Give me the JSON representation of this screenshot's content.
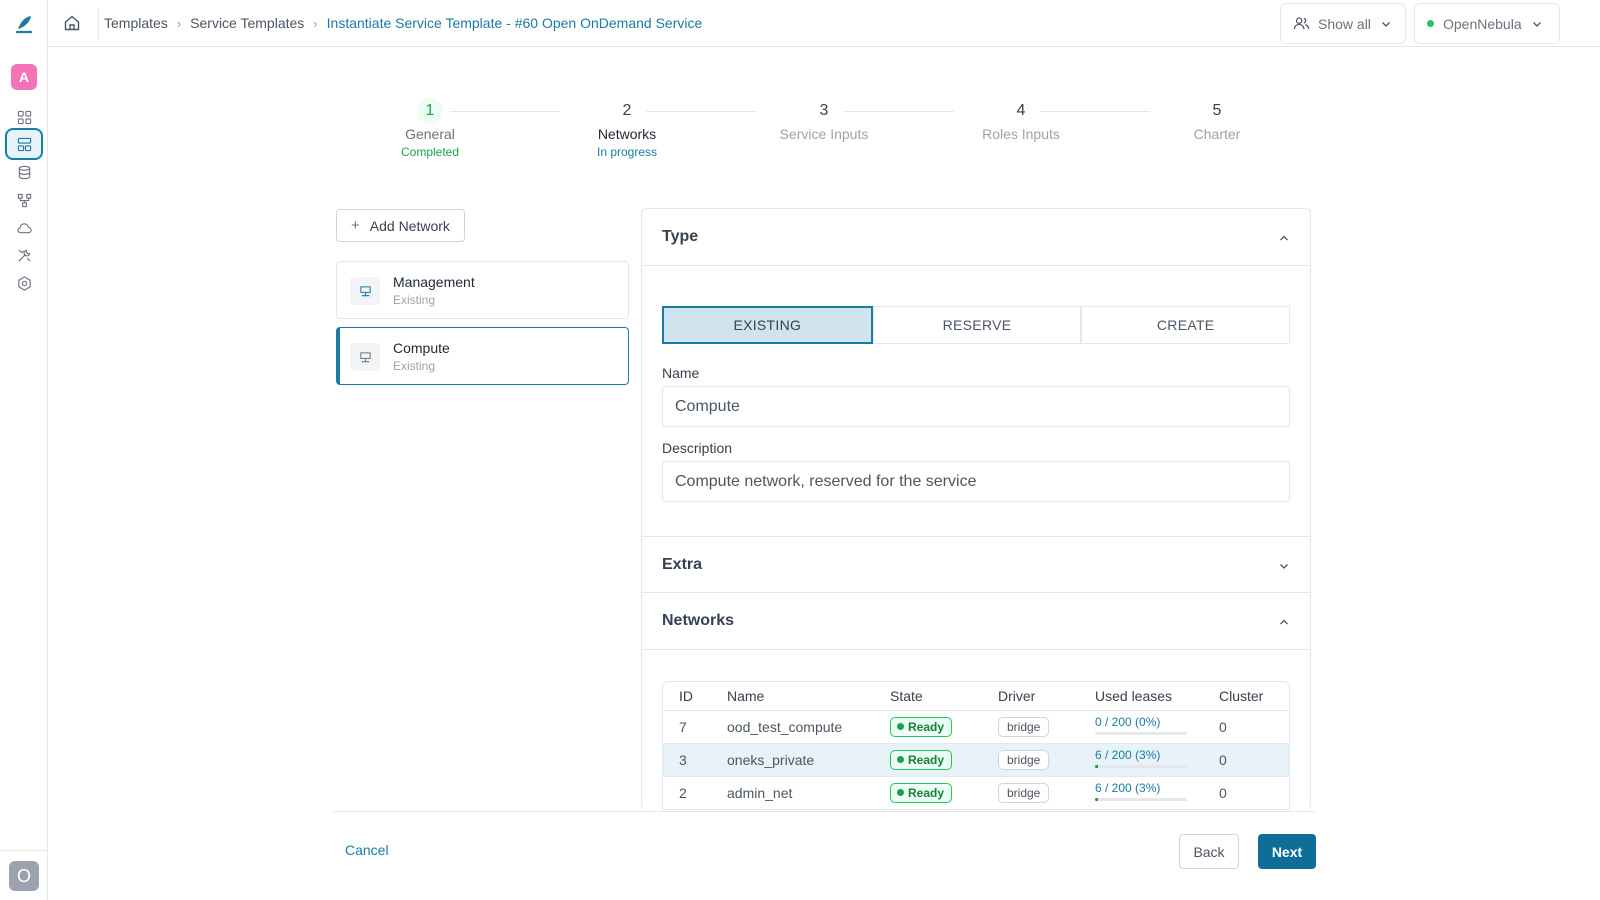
{
  "colors": {
    "accent": "#1a7ba3",
    "success": "#16a34a",
    "avatar": "#f472b6"
  },
  "sidebar": {
    "avatar_letter": "A",
    "user_letter": "O",
    "icons": [
      "dashboard-icon",
      "templates-icon",
      "storage-icon",
      "network-icon",
      "cloud-icon",
      "tools-icon",
      "settings-icon"
    ]
  },
  "header": {
    "breadcrumb": [
      "Templates",
      "Service Templates",
      "Instantiate Service Template - #60 Open OnDemand Service"
    ],
    "show_all_label": "Show all",
    "zone_label": "OpenNebula"
  },
  "stepper": {
    "steps": [
      {
        "number": "1",
        "label": "General",
        "status": "Completed"
      },
      {
        "number": "2",
        "label": "Networks",
        "status": "In progress"
      },
      {
        "number": "3",
        "label": "Service Inputs",
        "status": ""
      },
      {
        "number": "4",
        "label": "Roles Inputs",
        "status": ""
      },
      {
        "number": "5",
        "label": "Charter",
        "status": ""
      }
    ]
  },
  "left_panel": {
    "add_network_label": "Add Network",
    "networks": [
      {
        "name": "Management",
        "sub": "Existing"
      },
      {
        "name": "Compute",
        "sub": "Existing"
      }
    ]
  },
  "type_section": {
    "title": "Type",
    "tabs": [
      "EXISTING",
      "RESERVE",
      "CREATE"
    ],
    "selected_tab": "EXISTING",
    "name_label": "Name",
    "name_value": "Compute",
    "description_label": "Description",
    "description_value": "Compute network, reserved for the service"
  },
  "extra_section": {
    "title": "Extra"
  },
  "networks_section": {
    "title": "Networks",
    "columns": [
      "ID",
      "Name",
      "State",
      "Driver",
      "Used leases",
      "Cluster"
    ],
    "rows": [
      {
        "id": "7",
        "name": "ood_test_compute",
        "state": "Ready",
        "driver": "bridge",
        "leases": "0 / 200 (0%)",
        "lease_fraction": 0.0,
        "cluster": "0"
      },
      {
        "id": "3",
        "name": "oneks_private",
        "state": "Ready",
        "driver": "bridge",
        "leases": "6 / 200 (3%)",
        "lease_fraction": 0.03,
        "cluster": "0"
      },
      {
        "id": "2",
        "name": "admin_net",
        "state": "Ready",
        "driver": "bridge",
        "leases": "6 / 200 (3%)",
        "lease_fraction": 0.03,
        "cluster": "0"
      }
    ]
  },
  "footer": {
    "cancel_label": "Cancel",
    "back_label": "Back",
    "next_label": "Next"
  }
}
